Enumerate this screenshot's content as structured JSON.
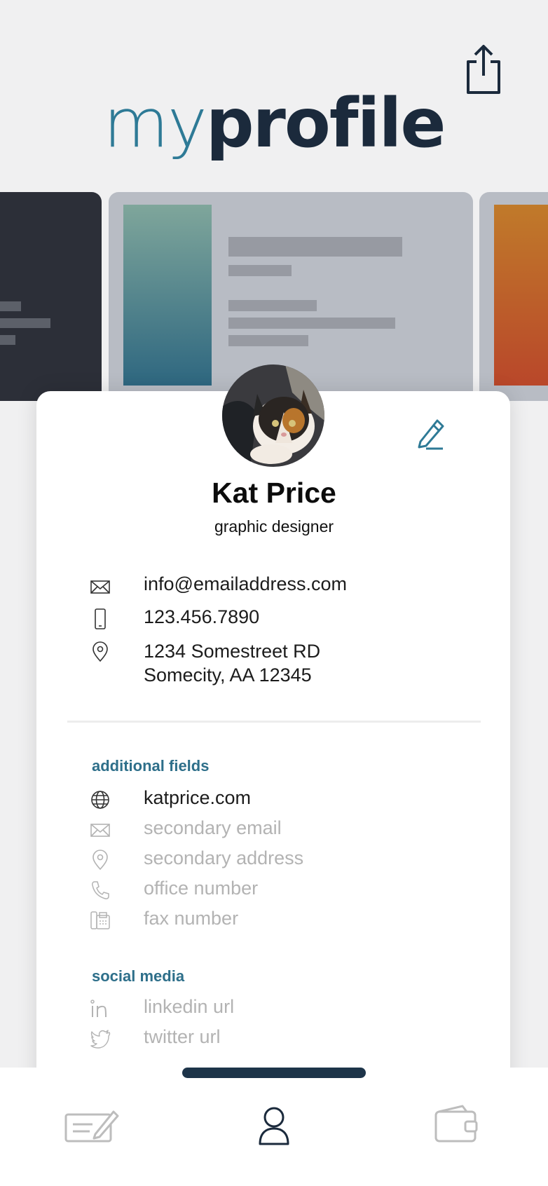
{
  "header": {
    "logo_light": "my",
    "logo_bold": "profile",
    "share_icon": "share-icon"
  },
  "profile": {
    "name": "Kat Price",
    "title": "graphic designer",
    "email": "info@emailaddress.com",
    "phone": "123.456.7890",
    "address_line1": "1234 Somestreet RD",
    "address_line2": "Somecity, AA 12345"
  },
  "additional": {
    "heading": "additional fields",
    "website": "katprice.com",
    "secondary_email": "secondary email",
    "secondary_address": "secondary address",
    "office_number": "office number",
    "fax_number": "fax number"
  },
  "social": {
    "heading": "social media",
    "linkedin": "linkedin url",
    "twitter": "twitter url"
  },
  "tabs": [
    "edit-card-icon",
    "profile-icon",
    "wallet-icon"
  ],
  "colors": {
    "accent": "#2e7a96",
    "navy": "#1b2a3c",
    "muted": "#b3b3b3"
  }
}
